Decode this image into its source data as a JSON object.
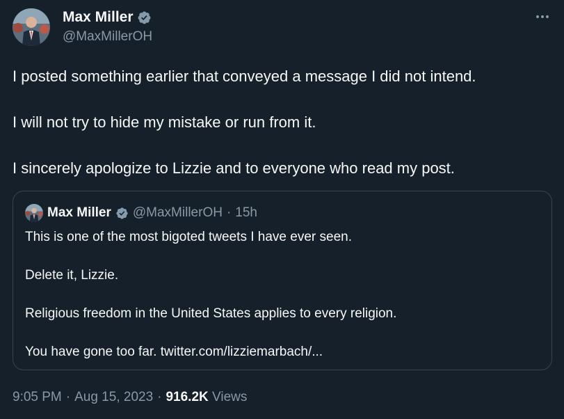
{
  "author": {
    "display_name": "Max Miller",
    "handle": "@MaxMillerOH",
    "verified": true
  },
  "tweet": {
    "paragraphs": [
      "I posted something earlier that conveyed a message I did not intend.",
      "I will not try to hide my mistake or run from it.",
      "I sincerely apologize to Lizzie and to everyone who read my post."
    ]
  },
  "quoted_tweet": {
    "display_name": "Max Miller",
    "handle": "@MaxMillerOH",
    "separator": "·",
    "time": "15h",
    "paragraphs": [
      "This is one of the most bigoted tweets I have ever seen.",
      "Delete it, Lizzie.",
      "Religious freedom in the United States applies to every religion.",
      "You have gone too far. twitter.com/lizziemarbach/..."
    ]
  },
  "meta": {
    "time": "9:05 PM",
    "separator": "·",
    "date": "Aug 15, 2023",
    "views_count": "916.2K",
    "views_label": "Views"
  },
  "icons": {
    "verified": "verified-badge-icon",
    "more": "more-options-icon"
  },
  "colors": {
    "background": "#15202b",
    "text": "#f7f9f9",
    "secondary_text": "#8b98a5",
    "border": "#38444d",
    "verified_badge": "#829aab"
  }
}
